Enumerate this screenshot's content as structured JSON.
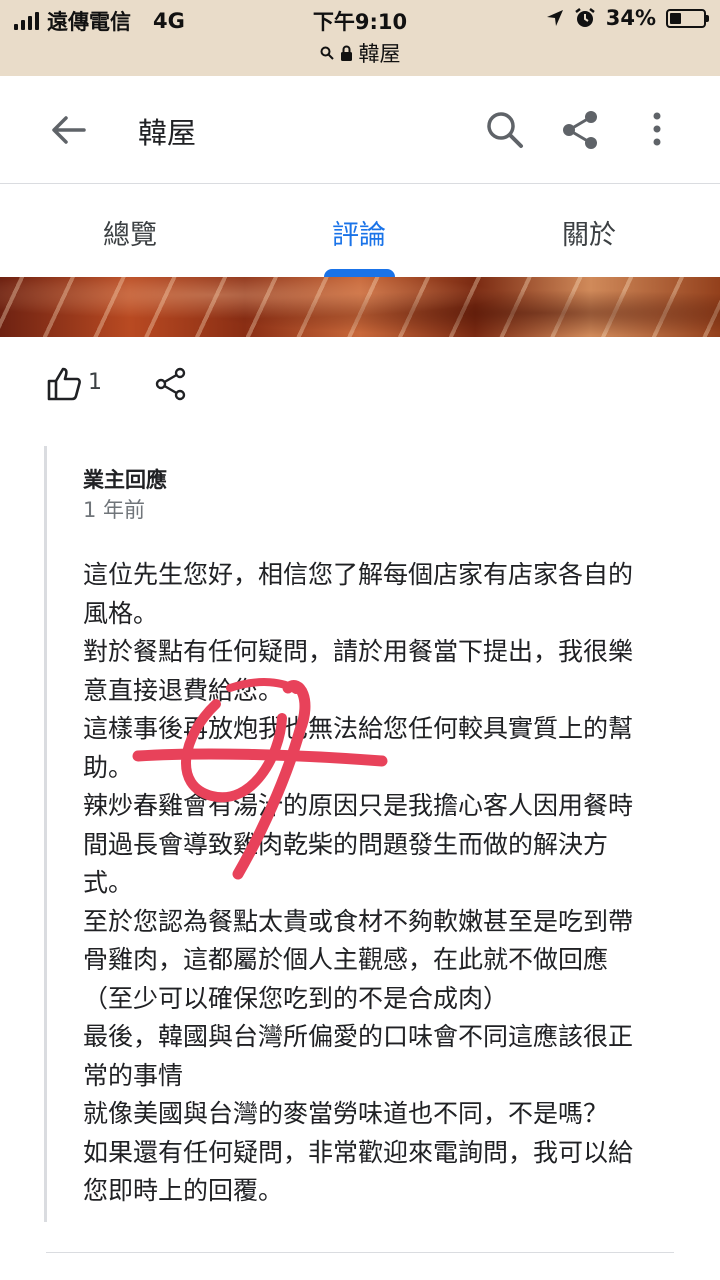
{
  "status_bar": {
    "carrier": "遠傳電信",
    "network": "4G",
    "time": "下午9:10",
    "battery": "34%",
    "battery_level": 0.34,
    "url": "韓屋"
  },
  "app_bar": {
    "title": "韓屋"
  },
  "tabs": [
    {
      "label": "總覽",
      "active": false
    },
    {
      "label": "評論",
      "active": true
    },
    {
      "label": "關於",
      "active": false
    }
  ],
  "review_actions": {
    "like_count": "1"
  },
  "owner_response": {
    "heading": "業主回應",
    "time": "1 年前",
    "lines": [
      "這位先生您好，相信您了解每個店家有店家各自的",
      "風格。",
      "對於餐點有任何疑問，請於用餐當下提出，我很樂",
      "意直接退費給您。",
      "這樣事後再放炮我也無法給您任何較具實質上的幫",
      "助。",
      "辣炒春雞會有湯汁的原因只是我擔心客人因用餐時",
      "間過長會導致雞肉乾柴的問題發生而做的解決方",
      "式。",
      "至於您認為餐點太貴或食材不夠軟嫩甚至是吃到帶",
      "骨雞肉，這都屬於個人主觀感，在此就不做回應",
      "（至少可以確保您吃到的不是合成肉）",
      "最後，韓國與台灣所偏愛的口味會不同這應該很正",
      "常的事情",
      "就像美國與台灣的麥當勞味道也不同，不是嗎？",
      "如果還有任何疑問，非常歡迎來電詢問，我可以給",
      "您即時上的回覆。"
    ]
  },
  "colors": {
    "accent": "#1a73e8",
    "status_bar_bg": "#e9dcc9",
    "annotation": "#e8425a"
  }
}
